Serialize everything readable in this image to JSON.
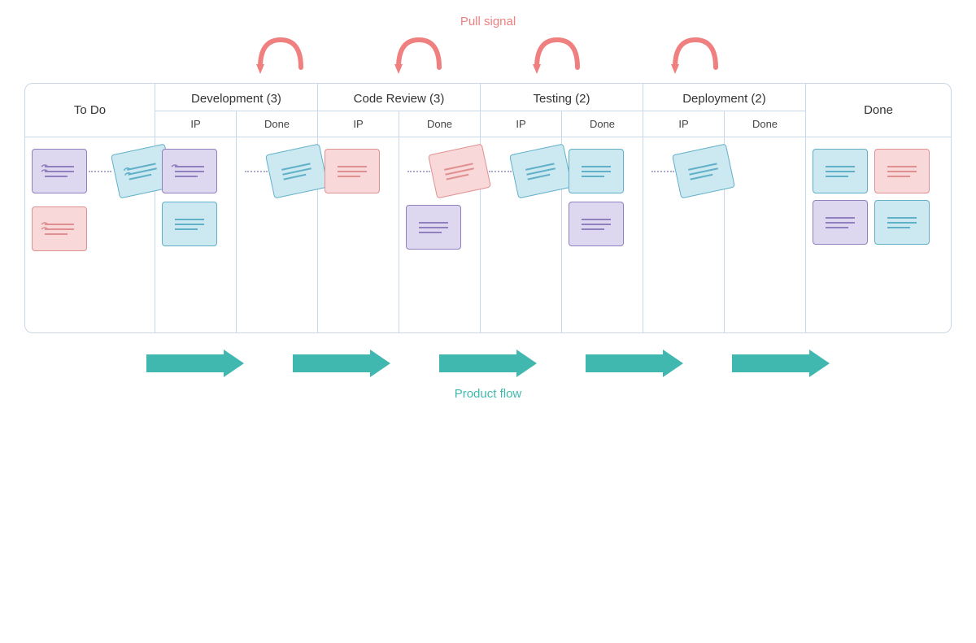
{
  "pull_signal": {
    "label": "Pull signal",
    "color": "#f08080",
    "arrows": [
      1,
      2,
      3,
      4
    ]
  },
  "product_flow": {
    "label": "Product flow",
    "color": "#40b8b0",
    "arrows": [
      1,
      2,
      3,
      4,
      5
    ]
  },
  "columns": [
    {
      "id": "todo",
      "label": "To Do",
      "type": "single"
    },
    {
      "id": "dev",
      "label": "Development (3)",
      "type": "multi",
      "subs": [
        "IP",
        "Done"
      ]
    },
    {
      "id": "cr",
      "label": "Code Review (3)",
      "type": "multi",
      "subs": [
        "IP",
        "Done"
      ]
    },
    {
      "id": "test",
      "label": "Testing (2)",
      "type": "multi",
      "subs": [
        "IP",
        "Done"
      ]
    },
    {
      "id": "deploy",
      "label": "Deployment (2)",
      "type": "multi",
      "subs": [
        "IP",
        "Done"
      ]
    },
    {
      "id": "done",
      "label": "Done",
      "type": "single"
    }
  ]
}
